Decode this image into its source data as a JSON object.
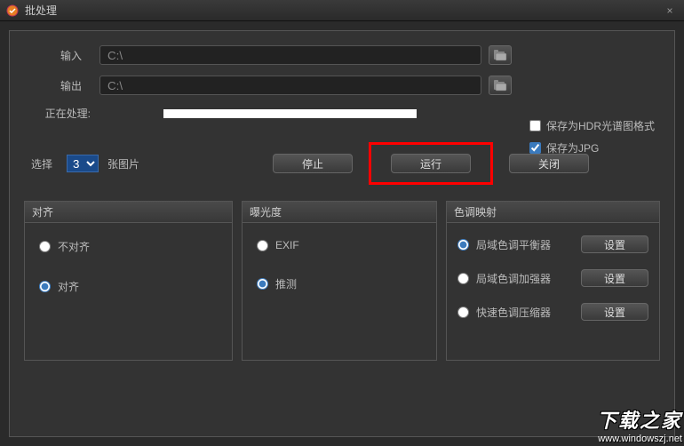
{
  "titlebar": {
    "title": "批处理",
    "close": "×"
  },
  "io": {
    "input_label": "输入",
    "input_value": "C:\\",
    "output_label": "输出",
    "output_value": "C:\\",
    "processing_label": "正在处理:"
  },
  "save": {
    "hdr_label": "保存为HDR光谱图格式",
    "jpg_label": "保存为JPG"
  },
  "select": {
    "label": "选择",
    "value": "3",
    "suffix": "张图片"
  },
  "buttons": {
    "stop": "停止",
    "run": "运行",
    "close": "关闭",
    "settings": "设置"
  },
  "sections": {
    "align": {
      "title": "对齐",
      "opt_none": "不对齐",
      "opt_align": "对齐"
    },
    "exposure": {
      "title": "曝光度",
      "opt_exif": "EXIF",
      "opt_guess": "推测"
    },
    "tone": {
      "title": "色调映射",
      "opt_balance": "局域色调平衡器",
      "opt_enhance": "局域色调加强器",
      "opt_compress": "快速色调压缩器"
    }
  },
  "watermark": {
    "big": "下载之家",
    "url": "www.windowszj.net"
  }
}
